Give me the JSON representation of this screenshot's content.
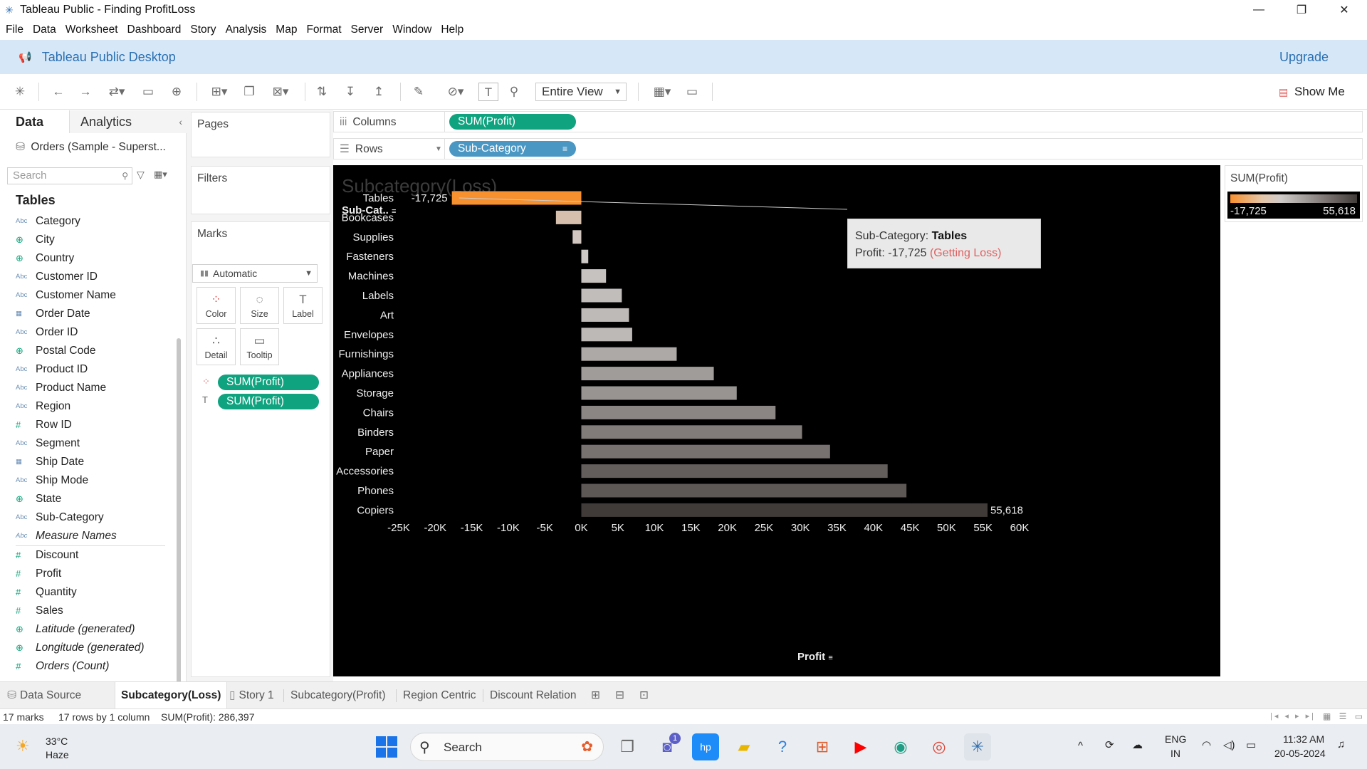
{
  "window": {
    "title": "Tableau Public - Finding ProfitLoss",
    "controls": [
      "—",
      "❐",
      "✕"
    ]
  },
  "menu": [
    "File",
    "Data",
    "Worksheet",
    "Dashboard",
    "Story",
    "Analysis",
    "Map",
    "Format",
    "Server",
    "Window",
    "Help"
  ],
  "banner": {
    "title": "Tableau Public Desktop",
    "upgrade": "Upgrade"
  },
  "toolbar": {
    "fit": "Entire View",
    "show_me": "Show Me"
  },
  "datapane": {
    "tab_data": "Data",
    "tab_analytics": "Analytics",
    "datasource": "Orders (Sample - Superst...",
    "search_placeholder": "Search",
    "tables_heading": "Tables",
    "dimensions": [
      {
        "name": "Category",
        "type": "Abc"
      },
      {
        "name": "City",
        "type": "geo"
      },
      {
        "name": "Country",
        "type": "geo"
      },
      {
        "name": "Customer ID",
        "type": "Abc"
      },
      {
        "name": "Customer Name",
        "type": "Abc"
      },
      {
        "name": "Order Date",
        "type": "date"
      },
      {
        "name": "Order ID",
        "type": "Abc"
      },
      {
        "name": "Postal Code",
        "type": "geo"
      },
      {
        "name": "Product ID",
        "type": "Abc"
      },
      {
        "name": "Product Name",
        "type": "Abc"
      },
      {
        "name": "Region",
        "type": "Abc"
      },
      {
        "name": "Row ID",
        "type": "#"
      },
      {
        "name": "Segment",
        "type": "Abc"
      },
      {
        "name": "Ship Date",
        "type": "date"
      },
      {
        "name": "Ship Mode",
        "type": "Abc"
      },
      {
        "name": "State",
        "type": "geo"
      },
      {
        "name": "Sub-Category",
        "type": "Abc"
      },
      {
        "name": "Measure Names",
        "type": "Abc",
        "italic": true
      }
    ],
    "measures": [
      {
        "name": "Discount",
        "type": "#"
      },
      {
        "name": "Profit",
        "type": "#"
      },
      {
        "name": "Quantity",
        "type": "#"
      },
      {
        "name": "Sales",
        "type": "#"
      },
      {
        "name": "Latitude (generated)",
        "type": "geo",
        "italic": true
      },
      {
        "name": "Longitude (generated)",
        "type": "geo",
        "italic": true
      },
      {
        "name": "Orders (Count)",
        "type": "#",
        "italic": true
      }
    ]
  },
  "cards": {
    "pages": "Pages",
    "filters": "Filters",
    "marks": "Marks",
    "marks_type": "Automatic",
    "mark_buttons": [
      "Color",
      "Size",
      "Label",
      "Detail",
      "Tooltip"
    ],
    "mark_pills": [
      "SUM(Profit)",
      "SUM(Profit)"
    ]
  },
  "shelves": {
    "columns_label": "Columns",
    "columns_pill": "SUM(Profit)",
    "rows_label": "Rows",
    "rows_pill": "Sub-Category"
  },
  "viz": {
    "sheet_title": "Subcategory(Loss)",
    "row_header": "Sub-Cat..",
    "x_title": "Profit",
    "tooltip": {
      "line1_label": "Sub-Category:",
      "line1_value": "Tables",
      "line2_label": "Profit:",
      "line2_value": "-17,725",
      "line2_note": "(Getting Loss)"
    }
  },
  "chart_data": {
    "type": "bar",
    "orientation": "horizontal",
    "title": "Subcategory(Loss)",
    "xlabel": "Profit",
    "ylabel": "Sub-Cat..",
    "categories": [
      "Tables",
      "Bookcases",
      "Supplies",
      "Fasteners",
      "Machines",
      "Labels",
      "Art",
      "Envelopes",
      "Furnishings",
      "Appliances",
      "Storage",
      "Chairs",
      "Binders",
      "Paper",
      "Accessories",
      "Phones",
      "Copiers"
    ],
    "values": [
      -17725,
      -3473,
      -1189,
      950,
      3385,
      5546,
      6528,
      6964,
      13059,
      18138,
      21279,
      26590,
      30222,
      34054,
      41937,
      44516,
      55618
    ],
    "xlim": [
      -25000,
      60000
    ],
    "xticks": [
      "-25K",
      "-20K",
      "-15K",
      "-10K",
      "-5K",
      "0K",
      "5K",
      "10K",
      "15K",
      "20K",
      "25K",
      "30K",
      "35K",
      "40K",
      "45K",
      "50K",
      "55K",
      "60K"
    ],
    "xtick_values": [
      -25000,
      -20000,
      -15000,
      -10000,
      -5000,
      0,
      5000,
      10000,
      15000,
      20000,
      25000,
      30000,
      35000,
      40000,
      45000,
      50000,
      55000,
      60000
    ],
    "labels": {
      "Tables": "-17,725",
      "Copiers": "55,618"
    },
    "colors": {
      "min": "#f7902e",
      "mid": "#cfcbc9",
      "max": "#403a38",
      "background": "#000000"
    },
    "grid": false,
    "legend": {
      "title": "SUM(Profit)",
      "min_label": "-17,725",
      "max_label": "55,618",
      "position": "top-right"
    }
  },
  "sheettabs": {
    "data_source": "Data Source",
    "tabs": [
      "Subcategory(Loss)",
      "Story 1",
      "Subcategory(Profit)",
      "Region Centric",
      "Discount Relation"
    ],
    "active": "Subcategory(Loss)"
  },
  "status": {
    "marks": "17 marks",
    "rows": "17 rows by 1 column",
    "sum": "SUM(Profit): 286,397"
  },
  "taskbar": {
    "temp": "33°C",
    "condition": "Haze",
    "search": "Search",
    "lang1": "ENG",
    "lang2": "IN",
    "time": "11:32 AM",
    "date": "20-05-2024",
    "teams_badge": "1"
  }
}
